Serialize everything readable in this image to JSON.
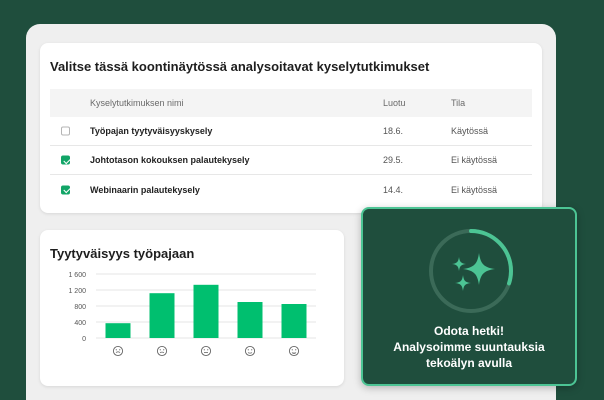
{
  "survey_selector": {
    "title": "Valitse tässä koontinäytössä analysoitavat kyselytutkimukset",
    "columns": {
      "name": "Kyselytutkimuksen nimi",
      "created": "Luotu",
      "status": "Tila"
    },
    "rows": [
      {
        "checked": false,
        "name": "Työpajan tyytyväisyyskysely",
        "created": "18.6.",
        "status": "Käytössä"
      },
      {
        "checked": true,
        "name": "Johtotason kokouksen palautekysely",
        "created": "29.5.",
        "status": "Ei käytössä"
      },
      {
        "checked": true,
        "name": "Webinaarin palautekysely",
        "created": "14.4.",
        "status": "Ei käytössä"
      }
    ]
  },
  "chart": {
    "title": "Tyytyväisyys työpajaan"
  },
  "chart_data": {
    "type": "bar",
    "title": "Tyytyväisyys työpajaan",
    "categories": [
      "very-dissatisfied-face-icon",
      "dissatisfied-face-icon",
      "neutral-face-icon",
      "satisfied-face-icon",
      "very-satisfied-face-icon"
    ],
    "values": [
      370,
      1120,
      1330,
      900,
      850
    ],
    "yticks": [
      "1 600",
      "1 200",
      "800",
      "400",
      "0"
    ],
    "ylim": [
      0,
      1600
    ],
    "grid": true,
    "bar_color": "#00bf6f"
  },
  "overlay": {
    "line1": "Odota hetki!",
    "line2": "Analysoimme suuntauksia",
    "line3": "tekoälyn avulla",
    "progress": 0.3,
    "icon": "sparkles-icon"
  },
  "colors": {
    "brand_dark": "#1f4e3d",
    "accent": "#00bf6f",
    "check": "#12a567"
  }
}
